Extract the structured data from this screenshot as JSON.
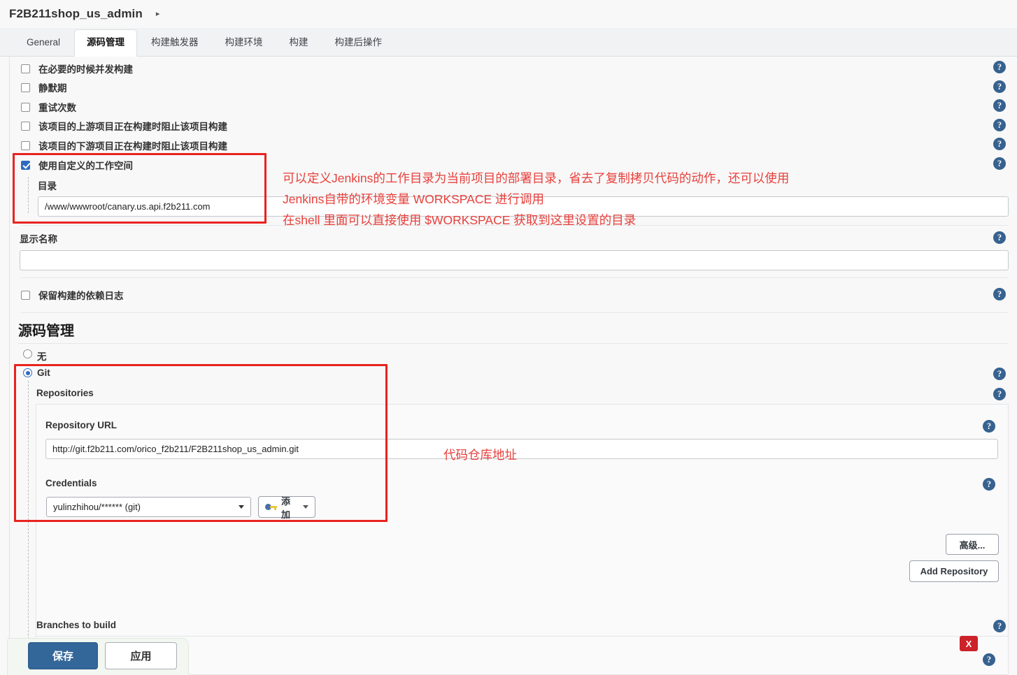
{
  "breadcrumb": {
    "title": "F2B211shop_us_admin",
    "caret": "▸"
  },
  "tabs": [
    {
      "label": "General",
      "active": false
    },
    {
      "label": "源码管理",
      "active": true
    },
    {
      "label": "构建触发器",
      "active": false
    },
    {
      "label": "构建环境",
      "active": false
    },
    {
      "label": "构建",
      "active": false
    },
    {
      "label": "构建后操作",
      "active": false
    }
  ],
  "checkboxes": [
    {
      "label": "在必要的时候并发构建",
      "checked": false
    },
    {
      "label": "静默期",
      "checked": false
    },
    {
      "label": "重试次数",
      "checked": false
    },
    {
      "label": "该项目的上游项目正在构建时阻止该项目构建",
      "checked": false
    },
    {
      "label": "该项目的下游项目正在构建时阻止该项目构建",
      "checked": false
    },
    {
      "label": "使用自定义的工作空间",
      "checked": true
    }
  ],
  "workspace": {
    "dir_label": "目录",
    "dir_value": "/www/wwwroot/canary.us.api.f2b211.com"
  },
  "display_name": {
    "label": "显示名称",
    "value": "",
    "placeholder": ""
  },
  "keep_dep_log": {
    "label": "保留构建的依赖日志",
    "checked": false
  },
  "scm": {
    "heading": "源码管理",
    "options": [
      {
        "label": "无",
        "selected": false
      },
      {
        "label": "Git",
        "selected": true
      }
    ],
    "repositories_label": "Repositories",
    "repository_url_label": "Repository URL",
    "repository_url_value": "http://git.f2b211.com/orico_f2b211/F2B211shop_us_admin.git",
    "credentials_label": "Credentials",
    "credentials_value": "yulinzhihou/****** (git)",
    "add_credentials_label": "添加",
    "advanced_label": "高级...",
    "add_repository_label": "Add Repository",
    "branches_label": "Branches to build"
  },
  "annotations": {
    "workspace_note_lines": [
      "可以定义Jenkins的工作目录为当前项目的部署目录，省去了复制拷贝代码的动作，还可以使用",
      "Jenkins自带的环境变量 WORKSPACE 进行调用",
      "在shell 里面可以直接使用 $WORKSPACE 获取到这里设置的目录"
    ],
    "repo_note": "代码仓库地址"
  },
  "footer": {
    "save_label": "保存",
    "apply_label": "应用",
    "close_label": "X"
  },
  "icons": {
    "help": "?"
  },
  "colors": {
    "accent": "#336699",
    "annotation_red": "#e8403c",
    "box_red": "#e8231f",
    "help_blue": "#37628f",
    "close_red": "#cc2229"
  }
}
